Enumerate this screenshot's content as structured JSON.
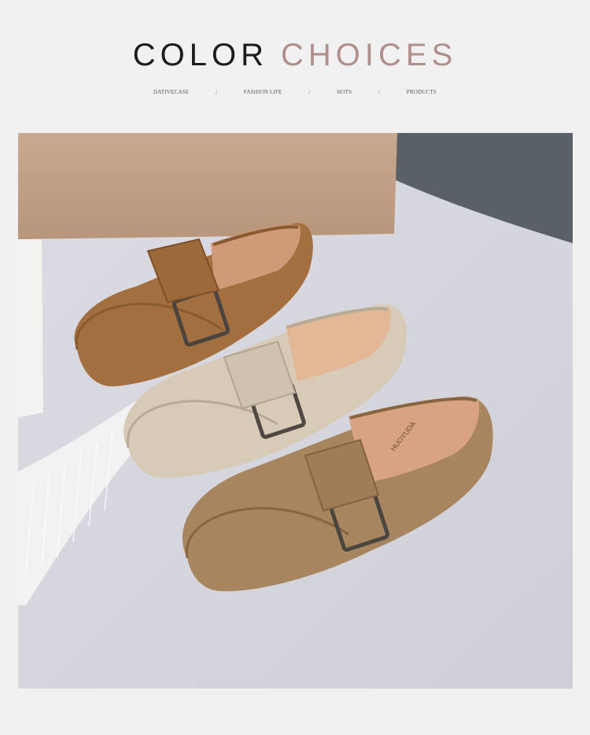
{
  "header": {
    "title_word1": "COLOR",
    "title_word2": "CHOICES",
    "nav": [
      "DATIVECASE",
      "FASHION LIFE",
      "HOTS",
      "PRODUCTS"
    ],
    "separator": "/"
  },
  "photo": {
    "insole_brand": "HUOYUDA",
    "colors": {
      "brown": "#a46f3f",
      "beige": "#d7cbb8",
      "khaki": "#a7855f"
    }
  }
}
